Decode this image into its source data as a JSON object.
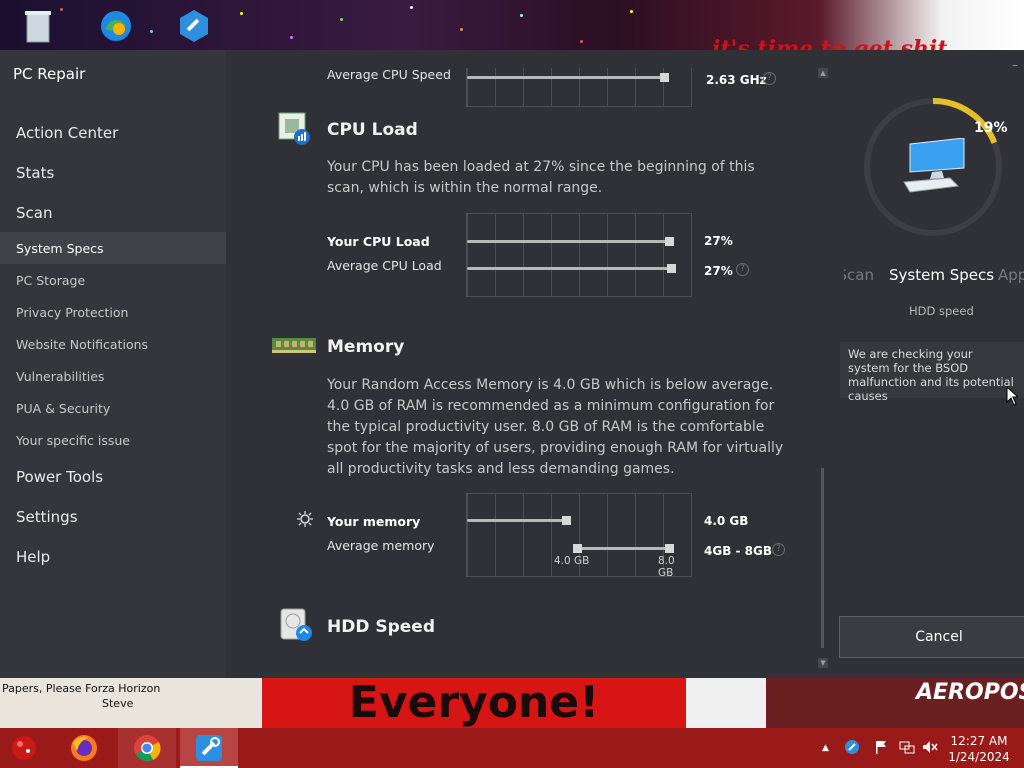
{
  "desktop": {
    "banner_text": "it's time to get shit",
    "icons": [
      "recycle-bin-icon",
      "edge-icon",
      "pc-repair-shortcut-icon"
    ]
  },
  "app": {
    "title": "PC Repair",
    "nav": {
      "main_items": [
        "Action Center",
        "Stats",
        "Scan"
      ],
      "scan_subitems": [
        "System Specs",
        "PC Storage",
        "Privacy Protection",
        "Website Notifications",
        "Vulnerabilities",
        "PUA & Security",
        "Your specific issue"
      ],
      "bottom_items": [
        "Power Tools",
        "Settings",
        "Help"
      ],
      "active": "System Specs"
    },
    "content": {
      "cpu_speed": {
        "label": "Average CPU Speed",
        "value": "2.63 GHz",
        "level": 0.88
      },
      "cpu_load": {
        "title": "CPU Load",
        "description": "Your CPU has been loaded at 27% since the beginning of this scan, which is within the normal range.",
        "your_label": "Your CPU Load",
        "your_value": "27%",
        "your_level": 0.9,
        "avg_label": "Average CPU Load",
        "avg_value": "27%",
        "avg_level": 0.91
      },
      "memory": {
        "title": "Memory",
        "description": "Your Random Access Memory is 4.0 GB which is below average. 4.0 GB of RAM is recommended as a minimum configuration for the typical productivity user. 8.0 GB of RAM is the comfortable spot for the majority of users, providing enough RAM for virtually all productivity tasks and less demanding games.",
        "your_label": "Your memory",
        "your_value": "4.0 GB",
        "your_level": 0.44,
        "avg_label": "Average memory",
        "avg_value": "4GB - 8GB",
        "avg_range": [
          0.49,
          0.9
        ],
        "range_low_label": "4.0 GB",
        "range_high_label": "8.0 GB"
      },
      "hdd": {
        "title": "HDD Speed"
      }
    },
    "progress": {
      "percent_text": "19%",
      "level": 0.19,
      "prev_step": "Scan",
      "current_step": "System Specs",
      "next_step": "Apps",
      "step_description": "HDD speed",
      "info": "We are checking your system for the BSOD malfunction and its potential causes",
      "cancel_label": "Cancel"
    }
  },
  "bottom_wallpaper": {
    "caption": "Papers, Please Forza Horizon",
    "caption2": "Steve",
    "big_text": "Everyone!",
    "right_text": "AEROPOS"
  },
  "taskbar": {
    "apps": [
      "start-orb-icon",
      "firefox-icon",
      "chrome-icon",
      "pc-repair-icon"
    ],
    "clock_time": "12:27 AM",
    "clock_date": "1/24/2024",
    "accent": "#9a1a1a"
  }
}
